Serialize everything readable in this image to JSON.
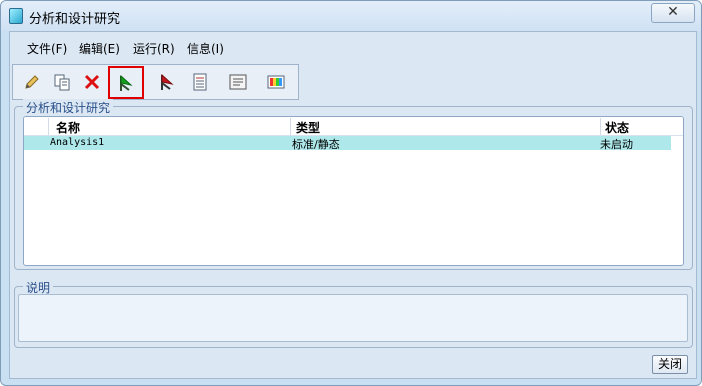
{
  "window": {
    "title": "分析和设计研究",
    "close_label": "✕"
  },
  "menu": [
    "文件(F)",
    "编辑(E)",
    "运行(R)",
    "信息(I)"
  ],
  "toolbar": {
    "tools": [
      "edit-icon",
      "copy-icon",
      "delete-icon",
      "run-green-flag-icon",
      "stop-red-flag-icon",
      "list-icon",
      "report-icon",
      "results-icon"
    ],
    "selected": "run-green-flag-icon"
  },
  "studies": {
    "label": "分析和设计研究",
    "columns": [
      "名称",
      "类型",
      "状态"
    ],
    "rows": [
      {
        "name": "Analysis1",
        "type": "标准/静态",
        "status": "未启动"
      }
    ]
  },
  "description": {
    "label": "说明",
    "text": ""
  },
  "footer": {
    "close_button": "关闭"
  },
  "colors": {
    "selected_row": "#aee8ea",
    "highlight_border": "#e00000",
    "window_bg": "#c9dff2"
  }
}
